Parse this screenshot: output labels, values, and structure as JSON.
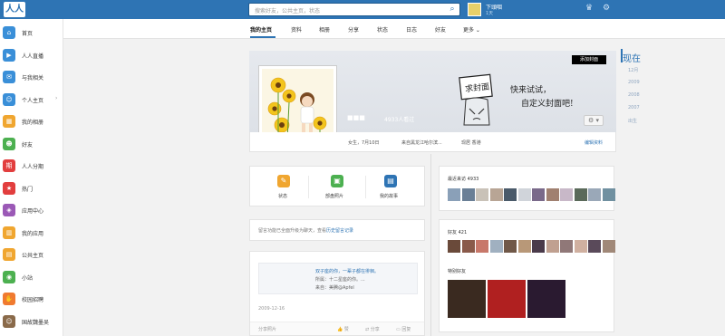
{
  "topbar": {
    "logo": "人人",
    "search_placeholder": "搜索好友，公共主页，状态",
    "user_name": "下頭咽",
    "user_sub": "1天"
  },
  "sidebar": {
    "items": [
      {
        "label": "首页",
        "color": "#3a8fd8",
        "icon": "home-icon"
      },
      {
        "label": "人人直播",
        "color": "#3a8fd8",
        "icon": "video-icon"
      },
      {
        "label": "与我相关",
        "color": "#3a8fd8",
        "icon": "chat-icon"
      },
      {
        "label": "个人主页",
        "color": "#3a8fd8",
        "icon": "person-icon"
      },
      {
        "label": "我的相册",
        "color": "#f0a630",
        "icon": "album-icon"
      },
      {
        "label": "好友",
        "color": "#4cb050",
        "icon": "friends-icon"
      },
      {
        "label": "人人分期",
        "color": "#e23e3e",
        "icon": "installment-icon"
      },
      {
        "label": "热门",
        "color": "#e23e3e",
        "icon": "fire-icon"
      },
      {
        "label": "应用中心",
        "color": "#9b59b6",
        "icon": "gamepad-icon"
      },
      {
        "label": "我的应用",
        "color": "#f0a630",
        "icon": "apps-icon"
      },
      {
        "label": "公共主页",
        "color": "#f0a630",
        "icon": "page-icon"
      },
      {
        "label": "小站",
        "color": "#4cb050",
        "icon": "station-icon"
      },
      {
        "label": "校园招聘",
        "color": "#f07a30",
        "icon": "hand-icon"
      },
      {
        "label": "国故魏墨吴",
        "color": "#8a6a4a",
        "icon": "avatar-icon"
      }
    ]
  },
  "subnav": {
    "tabs": [
      "我的主页",
      "资料",
      "相册",
      "分享",
      "状态",
      "日志",
      "好友",
      "更多 ⌄"
    ]
  },
  "cover": {
    "button": "添加封面",
    "text1": "快来试试，",
    "text2": "自定义封面吧!",
    "sign": "求封面"
  },
  "profile": {
    "name": "■■■",
    "visits": "4933人看过",
    "gender": "女生，7月10日",
    "hometown": "来自黑龙江哈尔滨...",
    "location": "现居 香港",
    "edit": "编辑资料"
  },
  "actions": [
    {
      "label": "状态",
      "color": "#f0a630"
    },
    {
      "label": "部盘照片",
      "color": "#4cb050"
    },
    {
      "label": "我的故事",
      "color": "#2e74b4"
    }
  ],
  "notice": {
    "text": "留言功能已全面升级为聊天，查看",
    "link": "历史留言记录"
  },
  "feed": {
    "line1": "双子座的你，一辈子都在徘徊。",
    "line2": "所属：十二星座的你。...",
    "line3": "来自：美腾@Apfel",
    "date": "2009-12-16",
    "share": "分享照片",
    "like": "赞",
    "repost": "分享",
    "reply": "回复"
  },
  "visitors": {
    "title": "最近来访 4933"
  },
  "friends": {
    "title": "好友 421",
    "special": "特别好友"
  },
  "years": {
    "now": "现在",
    "list": [
      "12月",
      "2009",
      "2008",
      "2007",
      "出生"
    ]
  }
}
